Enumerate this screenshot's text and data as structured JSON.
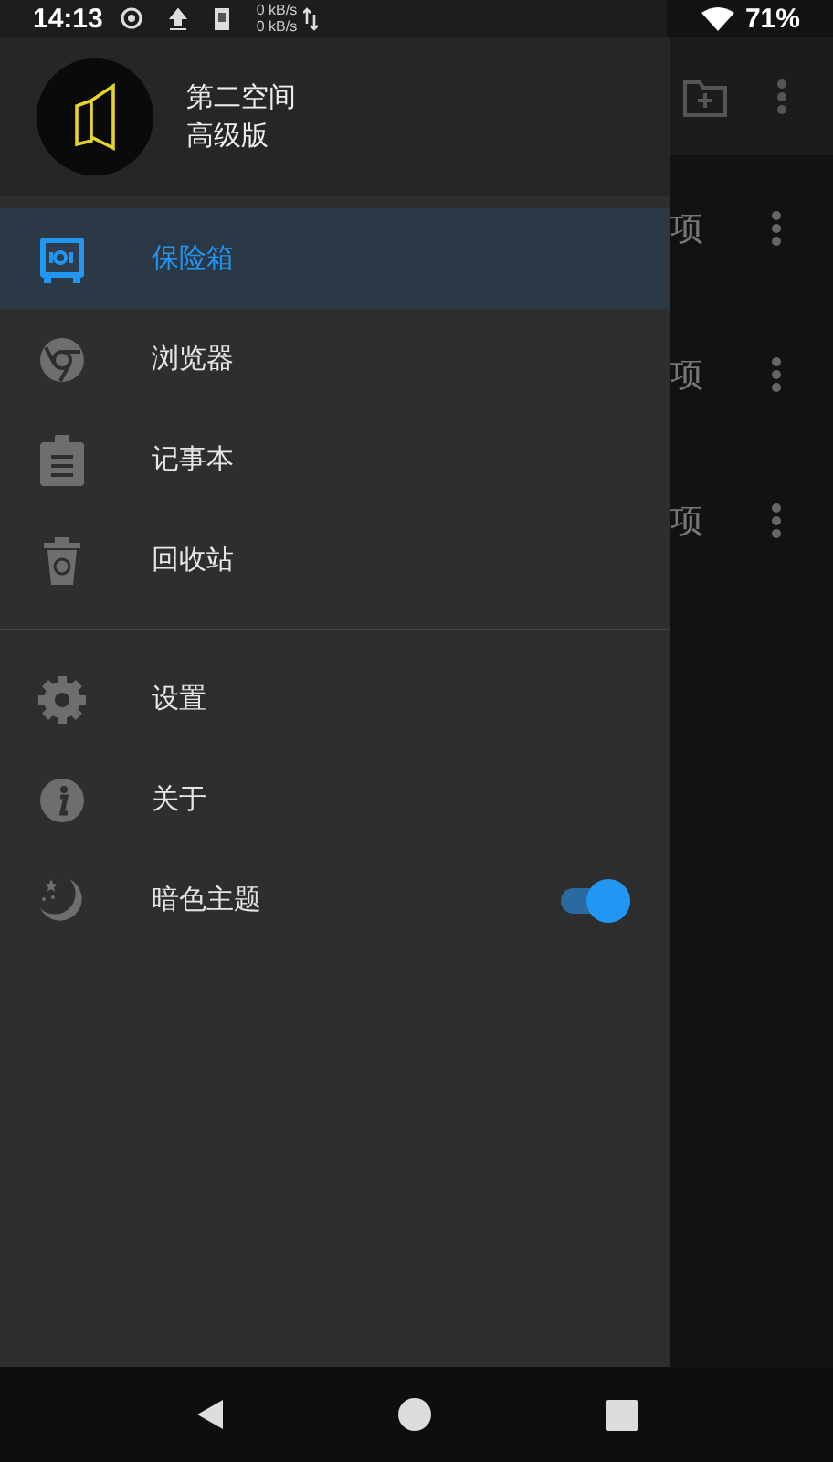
{
  "status_bar": {
    "time": "14:13",
    "speed_up": "0 kB/s",
    "speed_down": "0 kB/s",
    "battery": "71%"
  },
  "drawer": {
    "app_name": "第二空间",
    "edition": "高级版",
    "sections": [
      {
        "items": [
          {
            "label": "保险箱",
            "selected": true
          },
          {
            "label": "浏览器",
            "selected": false
          },
          {
            "label": "记事本",
            "selected": false
          },
          {
            "label": "回收站",
            "selected": false
          }
        ]
      },
      {
        "items": [
          {
            "label": "设置",
            "selected": false
          },
          {
            "label": "关于",
            "selected": false
          },
          {
            "label": "暗色主题",
            "selected": false,
            "toggle": {
              "on": true
            }
          }
        ]
      }
    ]
  },
  "background_list": {
    "rows": [
      {
        "text": "项"
      },
      {
        "text": "项"
      },
      {
        "text": "项"
      }
    ]
  }
}
